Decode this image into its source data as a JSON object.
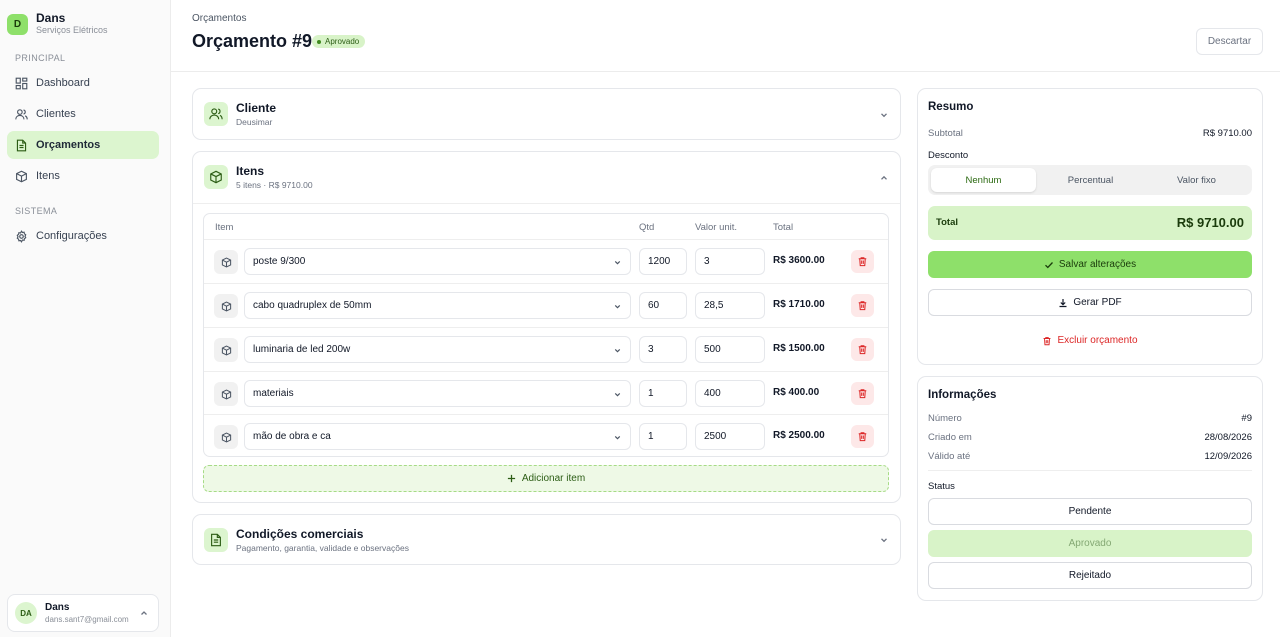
{
  "sidebar": {
    "brand": {
      "logo_letter": "D",
      "name": "Dans",
      "subtitle": "Serviços Elétricos"
    },
    "sections": [
      {
        "label": "PRINCIPAL"
      },
      {
        "label": "SISTEMA"
      }
    ],
    "items": [
      {
        "label": "Dashboard",
        "icon": "dashboard-icon",
        "active": false
      },
      {
        "label": "Clientes",
        "icon": "users-icon",
        "active": false
      },
      {
        "label": "Orçamentos",
        "icon": "document-icon",
        "active": true
      },
      {
        "label": "Itens",
        "icon": "box-icon",
        "active": false
      },
      {
        "label": "Configurações",
        "icon": "gear-icon",
        "active": false
      }
    ],
    "user": {
      "initials": "DA",
      "name": "Dans",
      "email": "dans.sant7@gmail.com"
    }
  },
  "header": {
    "breadcrumb": "Orçamentos",
    "title": "Orçamento #9",
    "status_badge": "Aprovado",
    "discard_label": "Descartar"
  },
  "client_section": {
    "title": "Cliente",
    "subtitle": "Deusimar"
  },
  "items_section": {
    "title": "Itens",
    "subtitle": "5 itens · R$ 9710.00",
    "columns": [
      "Item",
      "Qtd",
      "Valor unit.",
      "Total"
    ],
    "rows": [
      {
        "item": "poste 9/300",
        "qty": "1200",
        "unit": "3",
        "total": "R$ 3600.00"
      },
      {
        "item": "cabo quadruplex de 50mm",
        "qty": "60",
        "unit": "28,5",
        "total": "R$ 1710.00"
      },
      {
        "item": "luminaria de led 200w",
        "qty": "3",
        "unit": "500",
        "total": "R$ 1500.00"
      },
      {
        "item": "materiais",
        "qty": "1",
        "unit": "400",
        "total": "R$ 400.00"
      },
      {
        "item": "mão de obra e ca",
        "qty": "1",
        "unit": "2500",
        "total": "R$ 2500.00"
      }
    ],
    "add_label": "Adicionar item"
  },
  "conditions_section": {
    "title": "Condições comerciais",
    "subtitle": "Pagamento, garantia, validade e observações"
  },
  "summary": {
    "title": "Resumo",
    "subtotal_label": "Subtotal",
    "subtotal_value": "R$ 9710.00",
    "discount_label": "Desconto",
    "discount_options": [
      "Nenhum",
      "Percentual",
      "Valor fixo"
    ],
    "discount_selected": "Nenhum",
    "total_label": "Total",
    "total_value": "R$ 9710.00",
    "save_label": "Salvar alterações",
    "pdf_label": "Gerar PDF",
    "delete_label": "Excluir orçamento"
  },
  "info": {
    "title": "Informações",
    "number_label": "Número",
    "number_value": "#9",
    "created_label": "Criado em",
    "created_value": "28/08/2026",
    "valid_label": "Válido até",
    "valid_value": "12/09/2026",
    "status_label": "Status",
    "status_options": [
      "Pendente",
      "Aprovado",
      "Rejeitado"
    ],
    "status_selected": "Aprovado"
  },
  "colors": {
    "accent": "#8ee06a",
    "accent_light": "#d8f3c8",
    "danger": "#dc2626"
  }
}
